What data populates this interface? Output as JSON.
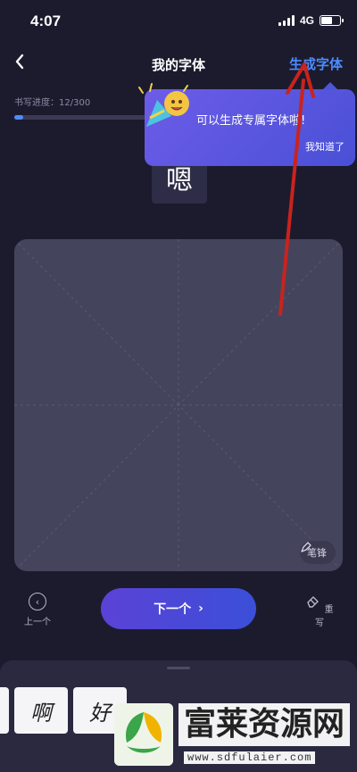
{
  "status_bar": {
    "time": "4:07",
    "network": "4G"
  },
  "nav": {
    "title": "我的字体",
    "action": "生成字体"
  },
  "progress": {
    "label": "书写进度：12/300",
    "current": 12,
    "total": 300,
    "fraction": 0.04
  },
  "current_char": "嗯",
  "tooltip": {
    "message": "可以生成专属字体啦!",
    "dismiss": "我知道了"
  },
  "canvas": {
    "brush_label": "笔锋"
  },
  "controls": {
    "prev_label": "上一个",
    "next_label": "下一个",
    "rewrite_label": "重写"
  },
  "glyphs": [
    "啊",
    "好"
  ],
  "watermark": {
    "text": "富莱资源网",
    "url": "www.sdfulaier.com"
  },
  "colors": {
    "background": "#1c1b2e",
    "accent": "#4d8bff",
    "button": "#5b42d6",
    "annotation": "#c9231e"
  },
  "icons": [
    "back-icon",
    "brush-icon",
    "prev-icon",
    "eraser-icon",
    "signal-icon",
    "battery-icon"
  ]
}
